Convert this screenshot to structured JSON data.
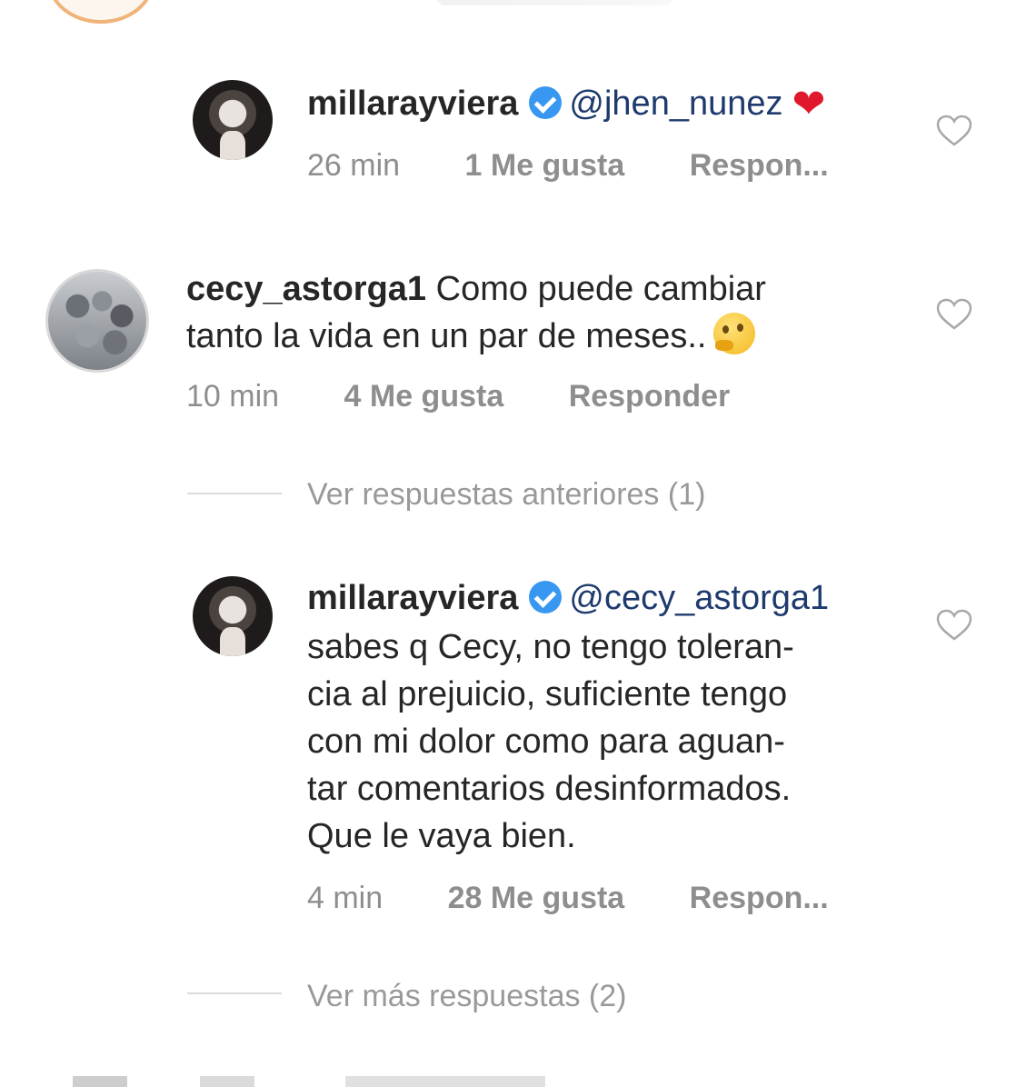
{
  "comments": [
    {
      "username": "millarayviera",
      "verified": true,
      "mention": "@jhen_nunez",
      "emoji": "❤",
      "time": "26 min",
      "likes": "1 Me gusta",
      "reply": "Respon..."
    },
    {
      "username": "cecy_astorga1",
      "verified": false,
      "text_line1": "Como puede cambiar",
      "text_line2": "tanto la vida en un par de meses..",
      "emoji": "thinking-face",
      "time": "10 min",
      "likes": "4 Me gusta",
      "reply": "Responder"
    },
    {
      "username": "millarayviera",
      "verified": true,
      "mention": "@cecy_astorga1",
      "lines": [
        "sabes q Cecy, no tengo toleran-",
        "cia al prejuicio, suficiente tengo",
        "con mi dolor como para aguan-",
        "tar comentarios desinformados.",
        "Que le vaya bien."
      ],
      "time": "4 min",
      "likes": "28 Me gusta",
      "reply": "Respon..."
    }
  ],
  "view_previous_replies": "Ver respuestas anteriores (1)",
  "view_more_replies": "Ver más respuestas (2)",
  "colors": {
    "text": "#262626",
    "meta": "#8e8e8e",
    "verified": "#3897f0",
    "heart": "#e0182b",
    "mention": "#1e3a6e"
  }
}
